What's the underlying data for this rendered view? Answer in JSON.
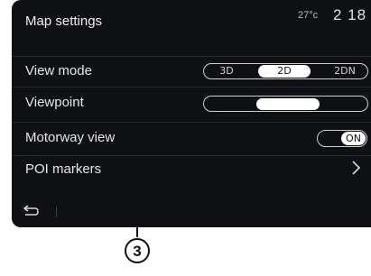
{
  "header": {
    "title": "Map settings",
    "temperature": "27°c",
    "time": "2 18"
  },
  "rows": {
    "view_mode": {
      "label": "View mode",
      "options": [
        "3D",
        "2D",
        "2DN"
      ],
      "selected": "2D"
    },
    "viewpoint": {
      "label": "Viewpoint"
    },
    "motorway_view": {
      "label": "Motorway view",
      "toggle": "ON"
    },
    "poi_markers": {
      "label": "POI markers"
    }
  },
  "callout": {
    "number": "3"
  },
  "icons": {
    "back": "back-arrow-icon",
    "chevron": "chevron-right-icon"
  },
  "colors": {
    "screen_bg": "#0e1014",
    "text": "#e6e6e6",
    "accent": "#ffffff"
  }
}
